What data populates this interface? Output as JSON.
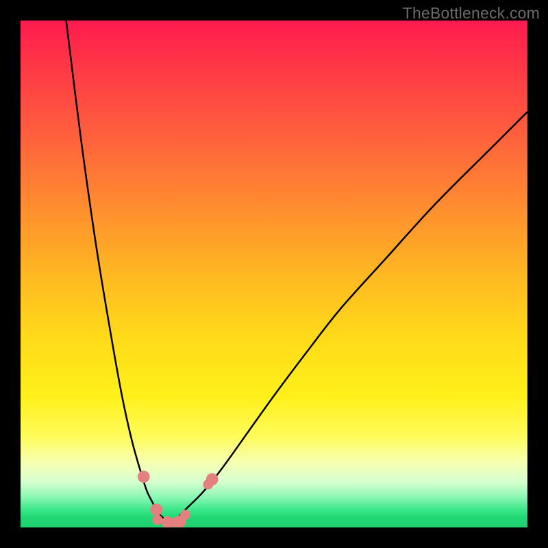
{
  "watermark": "TheBottleneck.com",
  "chart_data": {
    "type": "line",
    "title": "",
    "xlabel": "",
    "ylabel": "",
    "xlim": [
      0,
      100
    ],
    "ylim": [
      0,
      100
    ],
    "series": [
      {
        "name": "left-branch",
        "x": [
          9,
          12,
          15,
          18,
          20,
          22,
          24,
          25,
          26,
          27,
          28,
          29
        ],
        "y": [
          100,
          76,
          55,
          37,
          26,
          17,
          10,
          7,
          5,
          3,
          2,
          1
        ]
      },
      {
        "name": "right-branch",
        "x": [
          29,
          31,
          33,
          36,
          40,
          45,
          50,
          56,
          63,
          72,
          82,
          94,
          100
        ],
        "y": [
          1,
          2,
          4,
          7,
          12,
          19,
          26,
          34,
          43,
          53,
          64,
          76,
          82
        ]
      }
    ],
    "markers": [
      {
        "x": 24.3,
        "y": 10,
        "r": 1.2
      },
      {
        "x": 26.8,
        "y": 3.5,
        "r": 1.2
      },
      {
        "x": 27.0,
        "y": 1.5,
        "r": 1.0
      },
      {
        "x": 29.0,
        "y": 1.0,
        "r": 1.2
      },
      {
        "x": 30.5,
        "y": 1.0,
        "r": 1.0
      },
      {
        "x": 31.5,
        "y": 1.2,
        "r": 1.2
      },
      {
        "x": 32.5,
        "y": 2.5,
        "r": 1.0
      },
      {
        "x": 37.0,
        "y": 8.5,
        "r": 1.0
      },
      {
        "x": 37.8,
        "y": 9.5,
        "r": 1.2
      }
    ],
    "colors": {
      "curve": "#000000",
      "marker": "#e58080",
      "gradient_top": "#ff1a50",
      "gradient_bottom": "#1ecf70"
    }
  }
}
